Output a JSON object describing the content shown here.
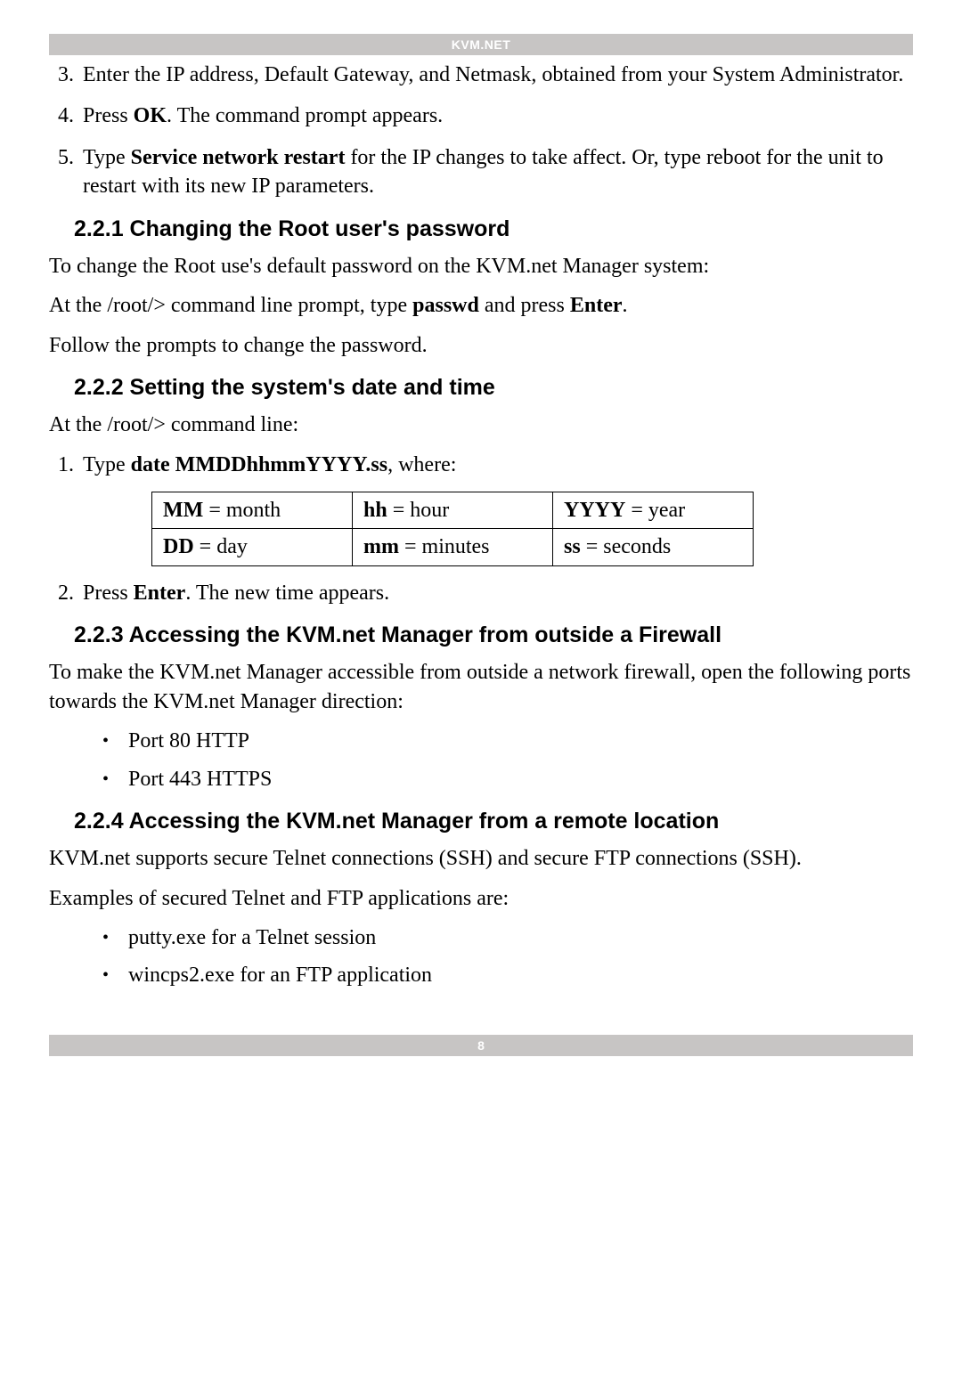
{
  "header": {
    "title": "KVM.NET"
  },
  "footer": {
    "page_number": "8"
  },
  "steps_top": [
    {
      "n": "3.",
      "text": "Enter the IP address, Default Gateway, and Netmask, obtained from your System Administrator."
    },
    {
      "n": "4.",
      "pre": "Press ",
      "bold": "OK",
      "post": ". The command prompt appears."
    },
    {
      "n": "5.",
      "pre": "Type ",
      "bold": "Service network restart",
      "post": " for the IP changes to take affect. Or, type reboot for the unit to restart with its new IP parameters."
    }
  ],
  "s221": {
    "heading": "2.2.1 Changing the Root user's password",
    "p1": "To change the Root use's default password on the KVM.net Manager system:",
    "p2_pre": "At the /root/> command line prompt, type ",
    "p2_b1": "passwd",
    "p2_mid": " and press ",
    "p2_b2": "Enter",
    "p2_post": ".",
    "p3": "Follow the prompts to change the password."
  },
  "s222": {
    "heading": "2.2.2 Setting the system's date and time",
    "p1": "At the /root/> command line:",
    "step1_n": "1.",
    "step1_pre": "Type ",
    "step1_b": "date MMDDhhmmYYYY.ss",
    "step1_post": ", where:",
    "table": {
      "r1c1_b": "MM",
      "r1c1_t": " = month",
      "r1c2_b": "hh",
      "r1c2_t": " = hour",
      "r1c3_b": "YYYY",
      "r1c3_t": " = year",
      "r2c1_b": "DD",
      "r2c1_t": " = day",
      "r2c2_b": "mm",
      "r2c2_t": " = minutes",
      "r2c3_b": "ss",
      "r2c3_t": " = seconds"
    },
    "step2_n": "2.",
    "step2_pre": "Press ",
    "step2_b": "Enter",
    "step2_post": ". The new time appears."
  },
  "s223": {
    "heading": "2.2.3 Accessing the KVM.net Manager from outside a Firewall",
    "p1": "To make the KVM.net Manager accessible from outside a network firewall, open the following ports towards the KVM.net Manager direction:",
    "bullets": [
      "Port 80 HTTP",
      "Port 443 HTTPS"
    ]
  },
  "s224": {
    "heading": "2.2.4 Accessing the KVM.net Manager from a remote location",
    "p1": "KVM.net supports secure Telnet connections (SSH) and secure FTP connections (SSH).",
    "p2": "Examples of secured Telnet and FTP applications are:",
    "bullets": [
      "putty.exe for a Telnet session",
      "wincps2.exe for an FTP application"
    ]
  }
}
